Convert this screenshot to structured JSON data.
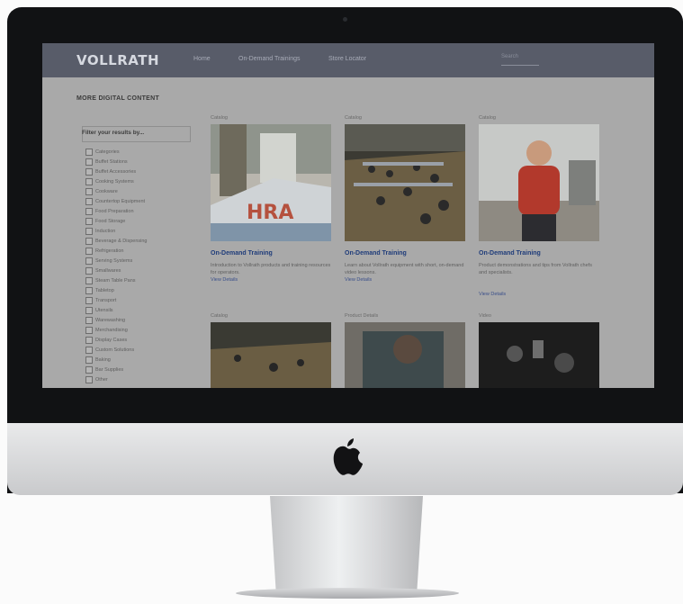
{
  "site": {
    "brand": "VOLLRATH",
    "nav": [
      "Home",
      "On-Demand Trainings",
      "Store Locator"
    ],
    "search_placeholder": "Search"
  },
  "page": {
    "title": "MORE DIGITAL CONTENT"
  },
  "sidebar": {
    "heading": "Filter your results by...",
    "items": [
      "Categories",
      "Buffet Stations",
      "Buffet Accessories",
      "Cooking Systems",
      "Cookware",
      "Countertop Equipment",
      "Food Preparation",
      "Food Storage",
      "Induction",
      "Beverage & Dispensing",
      "Refrigeration",
      "Serving Systems",
      "Smallwares",
      "Steam Table Pans",
      "Tabletop",
      "Transport",
      "Utensils",
      "Warewashing",
      "Merchandising",
      "Display Cases",
      "Custom Solutions",
      "Baking",
      "Bar Supplies",
      "Other"
    ]
  },
  "cards": [
    {
      "category": "Catalog",
      "title": "On-Demand Training",
      "desc": "Introduction to Vollrath products and training resources for operators.",
      "link": "View Details"
    },
    {
      "category": "Catalog",
      "title": "On-Demand Training",
      "desc": "Learn about Vollrath equipment with short, on-demand video lessons.",
      "link": "View Details"
    },
    {
      "category": "Catalog",
      "title": "On-Demand Training",
      "desc": "Product demonstrations and tips from Vollrath chefs and specialists.",
      "link": "View Details"
    },
    {
      "category": "Catalog",
      "title": "",
      "desc": "",
      "link": ""
    },
    {
      "category": "Product Details",
      "title": "",
      "desc": "",
      "link": ""
    },
    {
      "category": "Video",
      "title": "",
      "desc": "",
      "link": ""
    }
  ],
  "colors": {
    "nav_bg": "#585c69",
    "content_bg": "#a9a9a9",
    "link": "#1f3c7a"
  }
}
